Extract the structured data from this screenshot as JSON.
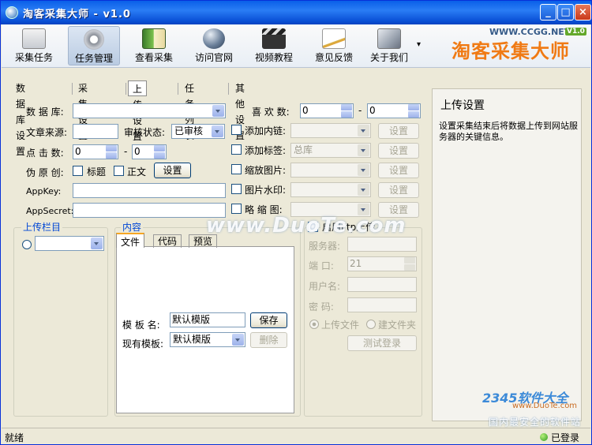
{
  "window": {
    "title": "淘客采集大师 - v1.0",
    "minimize": "_",
    "maximize": "□",
    "close": "×"
  },
  "toolbar": {
    "items": [
      {
        "label": "采集任务",
        "icon": "task-board-icon"
      },
      {
        "label": "任务管理",
        "icon": "gear-icon"
      },
      {
        "label": "查看采集",
        "icon": "book-icon"
      },
      {
        "label": "访问官网",
        "icon": "globe-icon"
      },
      {
        "label": "视频教程",
        "icon": "clapperboard-icon"
      },
      {
        "label": "意见反馈",
        "icon": "pencil-paper-icon"
      },
      {
        "label": "关于我们",
        "icon": "cube-icon"
      }
    ],
    "more": "▾"
  },
  "logo": {
    "url": "WWW.CCGG.NET",
    "version": "V1.0",
    "name": "淘客采集大师"
  },
  "tabs": [
    "数据库设置",
    "采集设置",
    "上传设置",
    "任务列表",
    "其他设置"
  ],
  "active_tab": "上传设置",
  "form": {
    "database_label": "数 据 库:",
    "source_label": "文章来源:",
    "review_label": "审核状态:",
    "review_value": "已审核",
    "clicks_label": "点 击 数:",
    "clicks_min": "0",
    "clicks_max": "0",
    "dash": "-",
    "fake_label": "伪 原 创:",
    "fake_title": "标题",
    "fake_body": "正文",
    "fake_settings": "设置",
    "appkey_label": "AppKey:",
    "appsecret_label": "AppSecret:",
    "likes_label": "喜 欢 数:",
    "likes_min": "0",
    "likes_max": "0",
    "options": [
      {
        "label": "添加内链:",
        "value": "",
        "button": "设置"
      },
      {
        "label": "添加标签:",
        "value": "总库",
        "button": "设置"
      },
      {
        "label": "缩放图片:",
        "value": "",
        "button": "设置"
      },
      {
        "label": "图片水印:",
        "value": "",
        "button": "设置"
      },
      {
        "label": "略 缩 图:",
        "value": "",
        "button": "设置"
      }
    ]
  },
  "upload_column": {
    "title": "上传栏目"
  },
  "content": {
    "title": "内容",
    "tabs": [
      "文件",
      "代码",
      "预览"
    ],
    "template_label": "模 板 名:",
    "template_value": "默认模版",
    "save_button": "保存",
    "existing_label": "现有模板:",
    "existing_value": "默认模版",
    "delete_button": "删除"
  },
  "ftp": {
    "enable_label": "启用Ftp上传",
    "server_label": "服务器:",
    "port_label": "端 口:",
    "port_value": "21",
    "user_label": "用户名:",
    "password_label": "密 码:",
    "upload_file": "上传文件",
    "create_folder": "建文件夹",
    "test_login": "测试登录"
  },
  "right_panel": {
    "title": "上传设置",
    "description": "设置采集结束后将数据上传到网站服务器的关键信息。"
  },
  "watermark": "www.DuoTe.com",
  "brand": {
    "name": "2345软件大全",
    "url": "www.DuoTe.com",
    "slogan": "国内最安全的软件站"
  },
  "status": {
    "left": "就绪",
    "right": "已登录"
  }
}
